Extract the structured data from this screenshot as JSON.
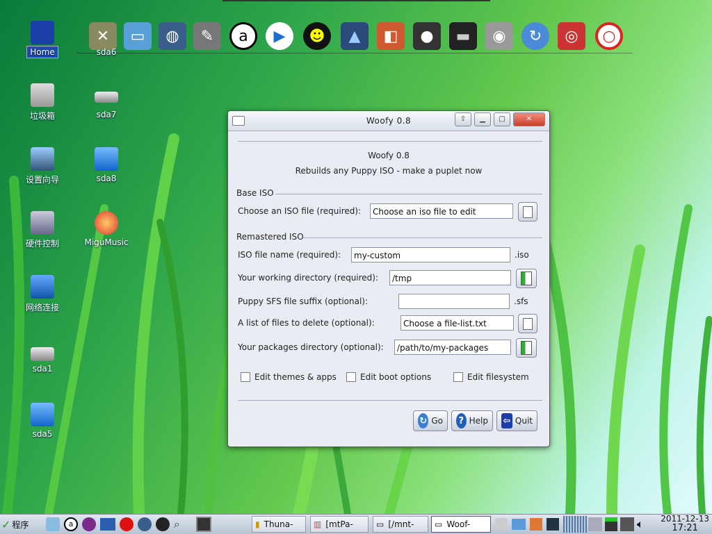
{
  "desktop": {
    "icons_col1": [
      {
        "label": "Home",
        "icon": "home-icon"
      },
      {
        "label": "垃圾箱",
        "icon": "trash-icon"
      },
      {
        "label": "设置向导",
        "icon": "settings-wizard-icon"
      },
      {
        "label": "硬件控制",
        "icon": "hardware-icon"
      },
      {
        "label": "网络连接",
        "icon": "network-icon"
      },
      {
        "label": "sda1",
        "icon": "drive-icon"
      },
      {
        "label": "sda5",
        "icon": "drive-icon"
      }
    ],
    "icons_col2": [
      {
        "label": "sda6",
        "icon": "drive-icon"
      },
      {
        "label": "sda7",
        "icon": "drive-icon"
      },
      {
        "label": "sda8",
        "icon": "drive-icon"
      },
      {
        "label": "MiguMusic",
        "icon": "music-icon"
      }
    ]
  },
  "window": {
    "title": "Woofy 0.8",
    "heading": "Woofy 0.8",
    "subheading": "Rebuilds any Puppy ISO - make a puplet now",
    "section_base": "Base ISO",
    "section_remaster": "Remastered ISO",
    "fields": {
      "iso_file": {
        "label": "Choose an ISO file (required):",
        "value": "Choose an iso file to edit"
      },
      "iso_name": {
        "label": "ISO file name (required):",
        "value": "my-custom",
        "suffix": ".iso"
      },
      "work_dir": {
        "label": "Your working directory (required):",
        "value": "/tmp"
      },
      "sfs_suffix": {
        "label": "Puppy SFS file suffix (optional):",
        "value": "",
        "suffix": ".sfs"
      },
      "delete_list": {
        "label": "A list of files to delete (optional):",
        "value": "Choose a file-list.txt"
      },
      "packages_dir": {
        "label": "Your packages directory (optional):",
        "value": "/path/to/my-packages"
      }
    },
    "checkboxes": {
      "themes": "Edit themes & apps",
      "boot": "Edit boot options",
      "filesystem": "Edit filesystem"
    },
    "buttons": {
      "go": "Go",
      "help": "Help",
      "quit": "Quit"
    }
  },
  "taskbar": {
    "start_label": "程序",
    "tasks": [
      "Thuna-",
      "[mtPa-",
      "[/mnt-",
      "Woof-"
    ],
    "date": "2011-12-13",
    "time": "17:21"
  },
  "colors": {
    "accent": "#1d4bb0",
    "desktop_green": "#2fa64a"
  }
}
